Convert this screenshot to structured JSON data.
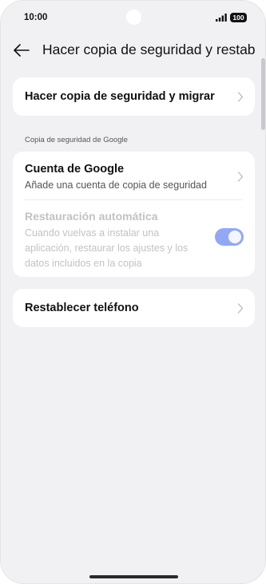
{
  "status_bar": {
    "time": "10:00",
    "battery": "100",
    "signal_icon": "signal-bars-icon"
  },
  "header": {
    "title": "Hacer copia de seguridad y restab...",
    "back_icon": "arrow-left-icon"
  },
  "backup_migrate": {
    "label": "Hacer copia de seguridad y migrar"
  },
  "google_section": {
    "label": "Copia de seguridad de Google",
    "account": {
      "title": "Cuenta de Google",
      "subtitle": "Añade una cuenta de copia de seguridad"
    },
    "auto_restore": {
      "title": "Restauración automática",
      "description": "Cuando vuelvas a instalar una aplicación, restaurar los ajustes y los datos incluidos en la copia",
      "enabled": true,
      "disabled": true
    }
  },
  "reset_phone": {
    "label": "Restablecer teléfono"
  },
  "colors": {
    "background": "#f1f1f3",
    "card": "#ffffff",
    "toggle_on_disabled": "#93a8f4",
    "disabled_text": "#c2c2c6"
  }
}
